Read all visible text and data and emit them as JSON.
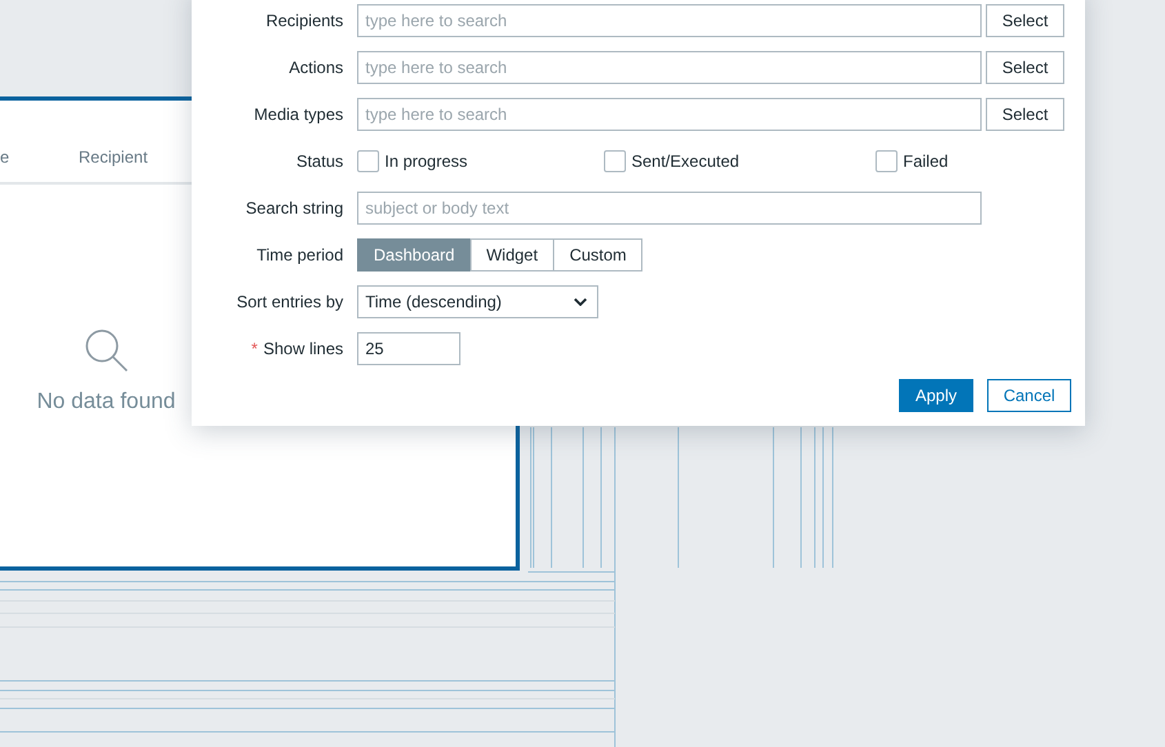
{
  "widget": {
    "columns": [
      "e",
      "Recipient"
    ],
    "empty_text": "No data found"
  },
  "filter": {
    "rows": [
      {
        "kind": "multiselect",
        "label": "Recipients",
        "placeholder": "type here to search",
        "button": "Select"
      },
      {
        "kind": "multiselect",
        "label": "Actions",
        "placeholder": "type here to search",
        "button": "Select"
      },
      {
        "kind": "multiselect",
        "label": "Media types",
        "placeholder": "type here to search",
        "button": "Select"
      },
      {
        "kind": "checkboxes",
        "label": "Status",
        "options": [
          {
            "label": "In progress",
            "checked": false
          },
          {
            "label": "Sent/Executed",
            "checked": false
          },
          {
            "label": "Failed",
            "checked": false
          }
        ]
      },
      {
        "kind": "text",
        "label": "Search string",
        "placeholder": "subject or body text"
      },
      {
        "kind": "segmented",
        "label": "Time period",
        "options": [
          {
            "label": "Dashboard",
            "selected": true
          },
          {
            "label": "Widget",
            "selected": false
          },
          {
            "label": "Custom",
            "selected": false
          }
        ]
      },
      {
        "kind": "select",
        "label": "Sort entries by",
        "value": "Time (descending)"
      },
      {
        "kind": "number",
        "label": "Show lines",
        "required_mark": "*",
        "value": "25"
      }
    ],
    "buttons": [
      {
        "label": "Apply",
        "kind": "primary"
      },
      {
        "label": "Cancel",
        "kind": "secondary"
      }
    ]
  }
}
